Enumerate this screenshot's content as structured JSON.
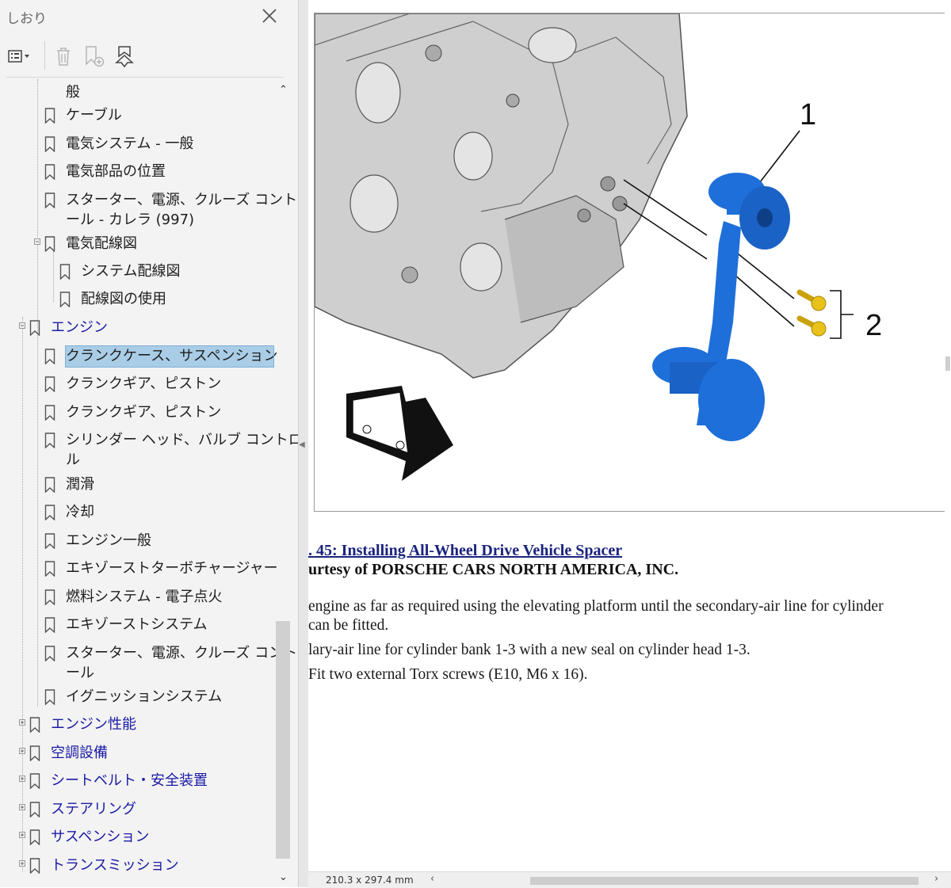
{
  "panel": {
    "title": "しおり",
    "toolbar": {
      "options_icon": "list-options-icon",
      "delete_icon": "trash-icon",
      "new_bookmark_icon": "new-bookmark-icon",
      "find_bookmark_icon": "find-current-bookmark-icon"
    },
    "items": [
      {
        "label": "般"
      },
      {
        "label": "ケーブル"
      },
      {
        "label": "電気システム - 一般"
      },
      {
        "label": "電気部品の位置"
      },
      {
        "label": "スターター、電源、クルーズ コントロ"
      },
      {
        "label": "ール - カレラ (997)"
      },
      {
        "label": "電気配線図"
      },
      {
        "label": "システム配線図"
      },
      {
        "label": "配線図の使用"
      },
      {
        "label": "エンジン"
      },
      {
        "label": "クランクケース、サスペンション"
      },
      {
        "label": "クランクギア、ピストン"
      },
      {
        "label": "クランクギア、ピストン"
      },
      {
        "label": "シリンダー ヘッド、バルブ コントロー"
      },
      {
        "label": "ル"
      },
      {
        "label": "潤滑"
      },
      {
        "label": "冷却"
      },
      {
        "label": "エンジン一般"
      },
      {
        "label": "エキゾーストターボチャージャー"
      },
      {
        "label": "燃料システム - 電子点火"
      },
      {
        "label": "エキゾーストシステム"
      },
      {
        "label": "スターター、電源、クルーズ コントロ"
      },
      {
        "label": "ール"
      },
      {
        "label": "イグニッションシステム"
      },
      {
        "label": "エンジン性能"
      },
      {
        "label": "空調設備"
      },
      {
        "label": "シートベルト・安全装置"
      },
      {
        "label": "ステアリング"
      },
      {
        "label": "サスペンション"
      },
      {
        "label": "トランスミッション"
      }
    ]
  },
  "document": {
    "figure": {
      "callout_1": "1",
      "callout_2": "2"
    },
    "caption": ". 45: Installing All-Wheel Drive Vehicle Spacer",
    "credit": "urtesy of PORSCHE CARS NORTH AMERICA, INC.",
    "paragraphs": [
      "engine as far as required using the elevating platform until the secondary-air line for cylinder",
      "can be fitted.",
      "lary-air line for cylinder bank 1-3 with a new seal on cylinder head 1-3.",
      " Fit two external Torx screws (E10, M6 x 16)."
    ]
  },
  "status_bar": {
    "page_size": "210.3 x 297.4 mm"
  },
  "colors": {
    "selection": "#a9cde6",
    "top_level_text": "#1a1aa6",
    "part_blue": "#1e6fd9",
    "screw_yellow": "#e8c21a"
  }
}
